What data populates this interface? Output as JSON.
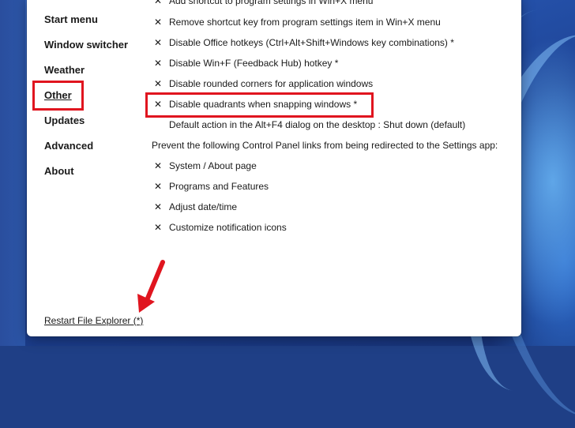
{
  "nav": {
    "items": [
      {
        "label": "Start menu",
        "active": false
      },
      {
        "label": "Window switcher",
        "active": false
      },
      {
        "label": "Weather",
        "active": false
      },
      {
        "label": "Other",
        "active": true
      },
      {
        "label": "Updates",
        "active": false
      },
      {
        "label": "Advanced",
        "active": false
      },
      {
        "label": "About",
        "active": false
      }
    ]
  },
  "settings": {
    "rows": [
      {
        "mark": "✕",
        "text": "Add shortcut to program settings in Win+X menu"
      },
      {
        "mark": "✕",
        "text": "Remove shortcut key from program settings item in Win+X menu"
      },
      {
        "mark": "✕",
        "text": "Disable Office hotkeys (Ctrl+Alt+Shift+Windows key combinations) *"
      },
      {
        "mark": "✕",
        "text": "Disable Win+F (Feedback Hub) hotkey *"
      },
      {
        "mark": "✕",
        "text": "Disable rounded corners for application windows"
      },
      {
        "mark": "✕",
        "text": "Disable quadrants when snapping windows *"
      },
      {
        "mark": "",
        "text": "Default action in the Alt+F4 dialog on the desktop : Shut down (default)"
      },
      {
        "mark": null,
        "text": "Prevent the following Control Panel links from being redirected to the Settings app:"
      },
      {
        "mark": "✕",
        "text": "System / About page"
      },
      {
        "mark": "✕",
        "text": "Programs and Features"
      },
      {
        "mark": "✕",
        "text": "Adjust date/time"
      },
      {
        "mark": "✕",
        "text": "Customize notification icons"
      }
    ]
  },
  "footer": {
    "restart_label": "Restart File Explorer (*)"
  },
  "colors": {
    "highlight": "#e0151f",
    "window_bg": "#ffffff",
    "wallpaper": "#2450a8"
  }
}
